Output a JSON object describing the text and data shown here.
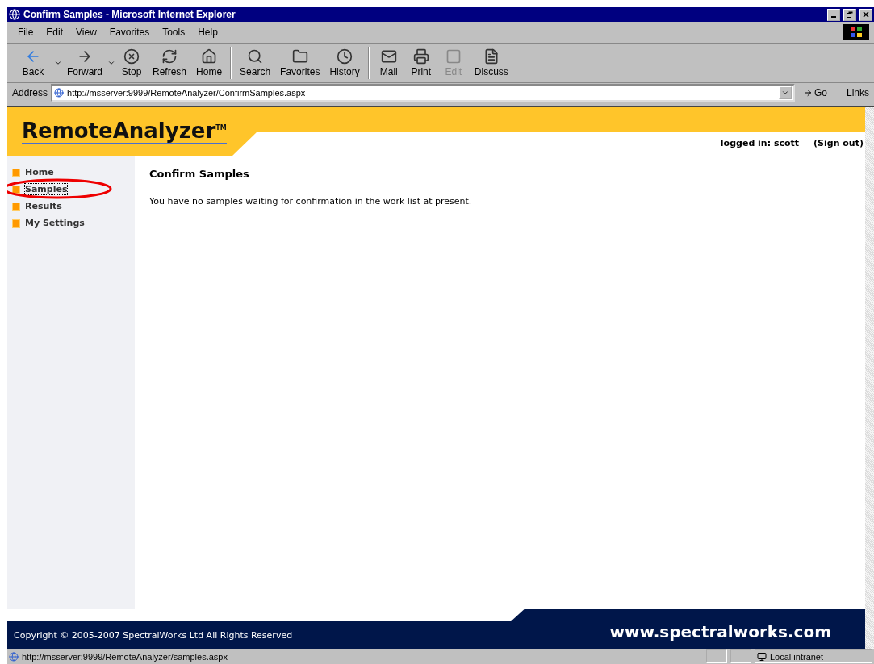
{
  "window": {
    "title": "Confirm Samples - Microsoft Internet Explorer"
  },
  "menu": [
    "File",
    "Edit",
    "View",
    "Favorites",
    "Tools",
    "Help"
  ],
  "toolbar": [
    {
      "kind": "back",
      "label": "Back",
      "disabled": false,
      "dropdown": true
    },
    {
      "kind": "forward",
      "label": "Forward",
      "disabled": false,
      "dropdown": true
    },
    {
      "kind": "stop",
      "label": "Stop",
      "disabled": false,
      "dropdown": false
    },
    {
      "kind": "refresh",
      "label": "Refresh",
      "disabled": false,
      "dropdown": false
    },
    {
      "kind": "home",
      "label": "Home",
      "disabled": false,
      "dropdown": false
    },
    {
      "kind": "search",
      "label": "Search",
      "disabled": false,
      "dropdown": false
    },
    {
      "kind": "favorites",
      "label": "Favorites",
      "disabled": false,
      "dropdown": false
    },
    {
      "kind": "history",
      "label": "History",
      "disabled": false,
      "dropdown": false
    },
    {
      "kind": "mail",
      "label": "Mail",
      "disabled": false,
      "dropdown": false
    },
    {
      "kind": "print",
      "label": "Print",
      "disabled": false,
      "dropdown": false
    },
    {
      "kind": "edit",
      "label": "Edit",
      "disabled": true,
      "dropdown": false
    },
    {
      "kind": "discuss",
      "label": "Discuss",
      "disabled": false,
      "dropdown": false
    }
  ],
  "address_bar": {
    "label": "Address",
    "value": "http://msserver:9999/RemoteAnalyzer/ConfirmSamples.aspx",
    "go": "Go",
    "links": "Links"
  },
  "page": {
    "logo": "RemoteAnalyzer",
    "trademark": "TM",
    "user": "logged in: scott",
    "sign_out": "(Sign out)",
    "nav": [
      {
        "label": "Home",
        "selected": false
      },
      {
        "label": "Samples",
        "selected": true
      },
      {
        "label": "Results",
        "selected": false
      },
      {
        "label": "My Settings",
        "selected": false
      }
    ],
    "heading": "Confirm Samples",
    "message": "You have no samples waiting for confirmation in the work list at present.",
    "copyright": "Copyright © 2005-2007 SpectralWorks Ltd  All Rights Reserved",
    "website": "www.spectralworks.com"
  },
  "status_bar": {
    "url": "http://msserver:9999/RemoteAnalyzer/samples.aspx",
    "zone": "Local intranet"
  }
}
